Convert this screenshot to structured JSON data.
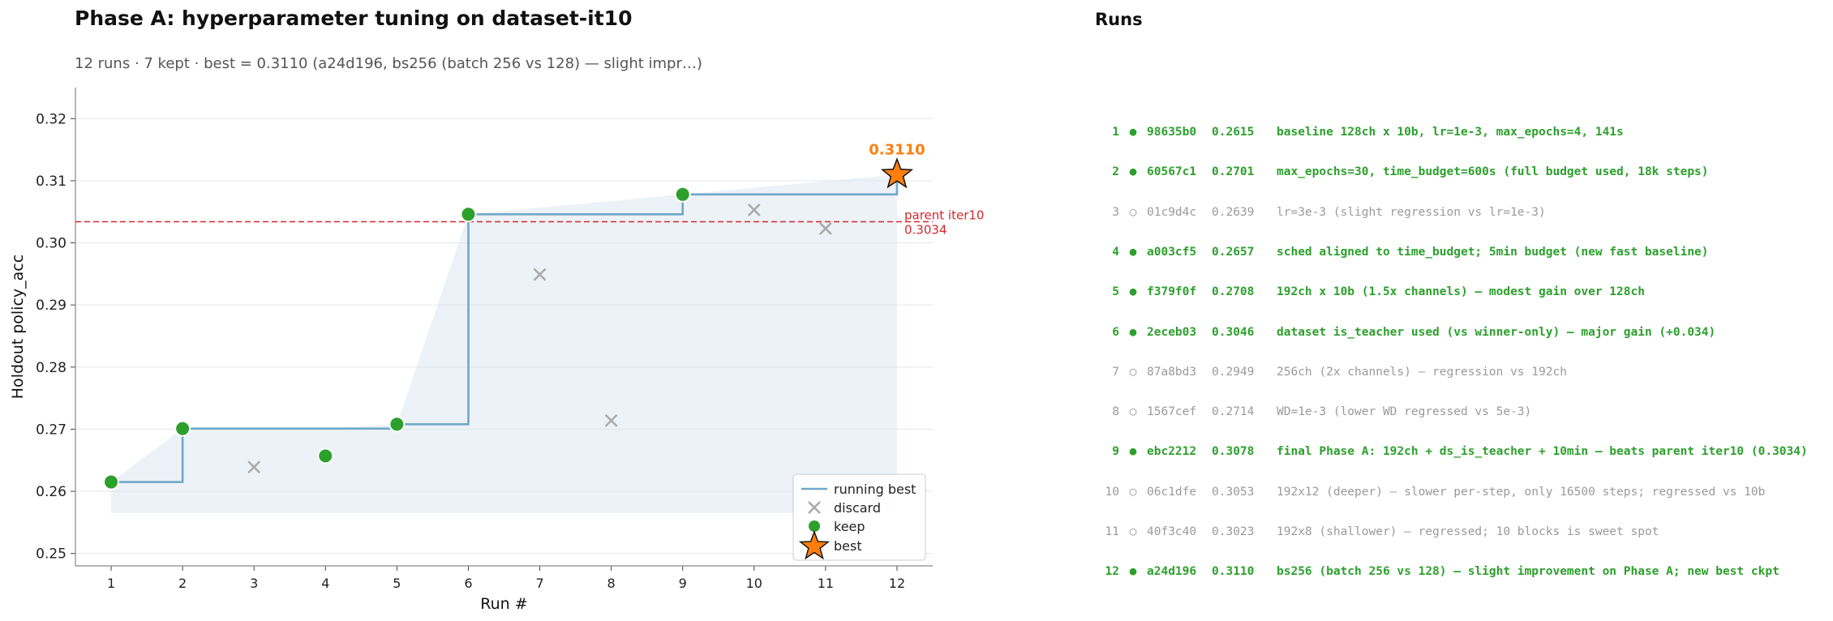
{
  "title": "Phase A: hyperparameter tuning on dataset-it10",
  "subtitle": "12 runs · 7 kept · best = 0.3110 (a24d196, bs256 (batch 256 vs 128) — slight impr…)",
  "colors": {
    "keep": "#2ca02c",
    "discard": "#aaaaaa",
    "running_best": "#6fa8c9",
    "best": "#ff7f0e",
    "parent": "#d62728"
  },
  "chart_data": {
    "type": "scatter",
    "xlabel": "Run #",
    "ylabel": "Holdout policy_acc",
    "xlim": [
      0.5,
      12.5
    ],
    "ylim": [
      0.248,
      0.325
    ],
    "x_ticks": [
      1,
      2,
      3,
      4,
      5,
      6,
      7,
      8,
      9,
      10,
      11,
      12
    ],
    "y_ticks": [
      "0.25",
      "0.26",
      "0.27",
      "0.28",
      "0.29",
      "0.30",
      "0.31",
      "0.32"
    ],
    "grid": "horizontal",
    "runs": [
      {
        "x": 1,
        "y": 0.2615,
        "kept": true
      },
      {
        "x": 2,
        "y": 0.2701,
        "kept": true
      },
      {
        "x": 3,
        "y": 0.2639,
        "kept": false
      },
      {
        "x": 4,
        "y": 0.2657,
        "kept": true
      },
      {
        "x": 5,
        "y": 0.2708,
        "kept": true
      },
      {
        "x": 6,
        "y": 0.3046,
        "kept": true
      },
      {
        "x": 7,
        "y": 0.2949,
        "kept": false
      },
      {
        "x": 8,
        "y": 0.2714,
        "kept": false
      },
      {
        "x": 9,
        "y": 0.3078,
        "kept": true
      },
      {
        "x": 10,
        "y": 0.3053,
        "kept": false
      },
      {
        "x": 11,
        "y": 0.3023,
        "kept": false
      },
      {
        "x": 12,
        "y": 0.311,
        "kept": true
      }
    ],
    "running_best": [
      0.2615,
      0.2701,
      0.2701,
      0.2701,
      0.2708,
      0.3046,
      0.3046,
      0.3046,
      0.3078,
      0.3078,
      0.3078,
      0.311
    ],
    "best": {
      "x": 12,
      "y": 0.311,
      "label": "0.3110"
    },
    "parent": {
      "y": 0.3034,
      "label_line1": "parent iter10",
      "label_line2": "0.3034"
    },
    "legend": {
      "position": "lower-right",
      "items": [
        "running best",
        "discard",
        "keep",
        "best"
      ]
    }
  },
  "runs_panel": {
    "title": "Runs",
    "rows": [
      {
        "num": "1",
        "mark": "●",
        "id": "98635b0",
        "score": "0.2615",
        "desc": "baseline 128ch x 10b, lr=1e-3, max_epochs=4, 141s",
        "kept": true
      },
      {
        "num": "2",
        "mark": "●",
        "id": "60567c1",
        "score": "0.2701",
        "desc": "max_epochs=30, time_budget=600s (full budget used, 18k steps)",
        "kept": true
      },
      {
        "num": "3",
        "mark": "○",
        "id": "01c9d4c",
        "score": "0.2639",
        "desc": "lr=3e-3 (slight regression vs lr=1e-3)",
        "kept": false
      },
      {
        "num": "4",
        "mark": "●",
        "id": "a003cf5",
        "score": "0.2657",
        "desc": "sched aligned to time_budget; 5min budget (new fast baseline)",
        "kept": true
      },
      {
        "num": "5",
        "mark": "●",
        "id": "f379f0f",
        "score": "0.2708",
        "desc": "192ch x 10b (1.5x channels) — modest gain over 128ch",
        "kept": true
      },
      {
        "num": "6",
        "mark": "●",
        "id": "2eceb03",
        "score": "0.3046",
        "desc": "dataset is_teacher used (vs winner-only) — major gain (+0.034)",
        "kept": true
      },
      {
        "num": "7",
        "mark": "○",
        "id": "87a8bd3",
        "score": "0.2949",
        "desc": "256ch (2x channels) — regression vs 192ch",
        "kept": false
      },
      {
        "num": "8",
        "mark": "○",
        "id": "1567cef",
        "score": "0.2714",
        "desc": "WD=1e-3 (lower WD regressed vs 5e-3)",
        "kept": false
      },
      {
        "num": "9",
        "mark": "●",
        "id": "ebc2212",
        "score": "0.3078",
        "desc": "final Phase A: 192ch + ds_is_teacher + 10min — beats parent iter10 (0.3034)",
        "kept": true
      },
      {
        "num": "10",
        "mark": "○",
        "id": "06c1dfe",
        "score": "0.3053",
        "desc": "192x12 (deeper) — slower per-step, only 16500 steps; regressed vs 10b",
        "kept": false
      },
      {
        "num": "11",
        "mark": "○",
        "id": "40f3c40",
        "score": "0.3023",
        "desc": "192x8 (shallower) — regressed; 10 blocks is sweet spot",
        "kept": false
      },
      {
        "num": "12",
        "mark": "●",
        "id": "a24d196",
        "score": "0.3110",
        "desc": "bs256 (batch 256 vs 128) — slight improvement on Phase A; new best ckpt",
        "kept": true
      }
    ]
  }
}
